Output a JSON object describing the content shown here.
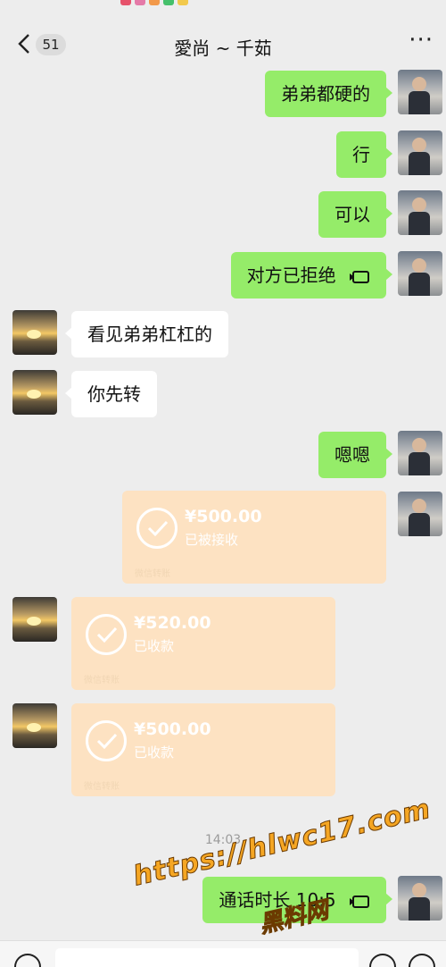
{
  "header": {
    "back_badge": "51",
    "title": "愛尚 ~ 千茹",
    "more": "···"
  },
  "messages": [
    {
      "side": "me",
      "text": "弟弟都硬的"
    },
    {
      "side": "me",
      "text": "行"
    },
    {
      "side": "me",
      "text": "可以"
    },
    {
      "side": "me",
      "text": "对方已拒绝"
    },
    {
      "side": "other",
      "text": "看见弟弟杠杠的"
    },
    {
      "side": "other",
      "text": "你先转"
    },
    {
      "side": "me",
      "text": "嗯嗯"
    },
    {
      "side": "me",
      "amount": "¥500.00",
      "state": "已被接收",
      "footer": "微信转账"
    },
    {
      "side": "other",
      "amount": "¥520.00",
      "state": "已收款",
      "footer": "微信转账"
    },
    {
      "side": "other",
      "amount": "¥500.00",
      "state": "已收款",
      "footer": "微信转账"
    },
    {
      "side": "me",
      "text": "通话时长 10:5"
    }
  ],
  "timestamp": "14:03",
  "watermark": {
    "url": "https://hlwc17.com",
    "name": "黑料网"
  },
  "icons": {
    "back": "chevron-left-icon",
    "video_call": "video-call-icon",
    "transfer_done": "check-circle-icon",
    "voice": "voice-icon",
    "emoji": "emoji-icon",
    "plus": "plus-icon"
  },
  "colors": {
    "background": "#ededed",
    "my_bubble": "#95ec69",
    "their_bubble": "#ffffff",
    "transfer_card": "#fde2c2",
    "watermark": "#f5a623"
  }
}
